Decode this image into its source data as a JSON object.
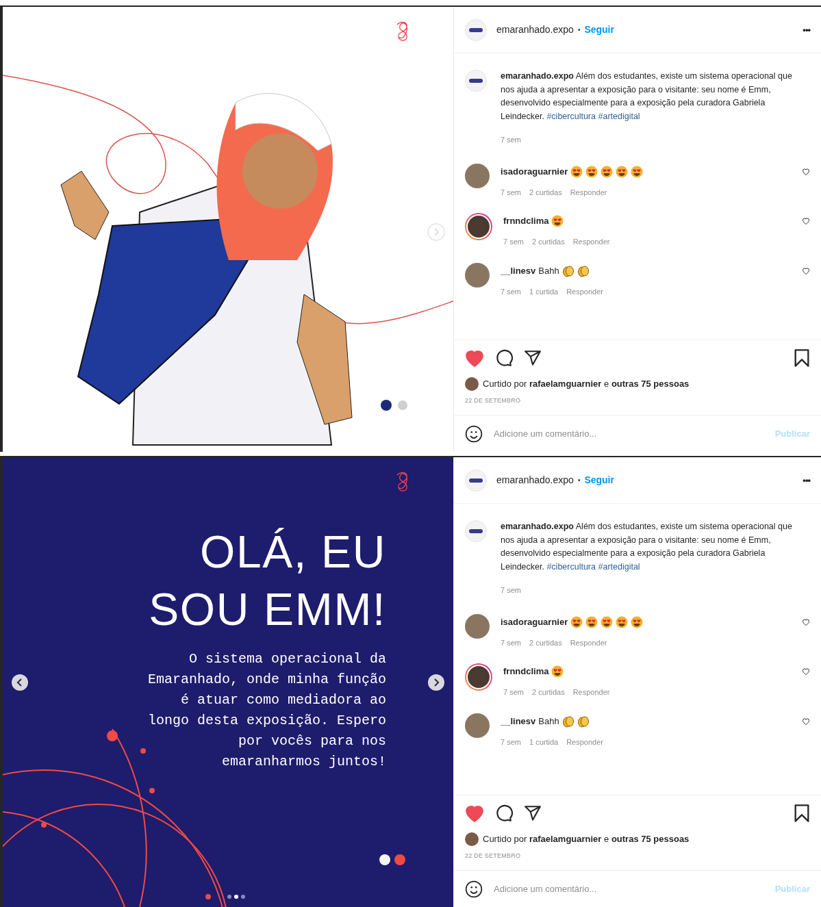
{
  "posts": [
    {
      "media": {
        "kind": "illustration",
        "arrows": [
          {
            "kind": "next"
          }
        ]
      },
      "header": {
        "username": "emaranhado.expo",
        "separator": "•",
        "follow": "Seguir",
        "more": "•••"
      },
      "caption": {
        "username": "emaranhado.expo",
        "text": "Além dos estudantes, existe um sistema operacional que nos ajuda a apresentar a exposição para o visitante: seu nome é Emm, desenvolvido especialmente para a exposição pela curadora Gabriela Leindecker.",
        "hashtags": [
          "#cibercultura",
          "#artedigital"
        ],
        "time": "7 sem"
      },
      "comments": [
        {
          "username": "isadoraguarnier",
          "emojis": [
            {
              "kind": "heart_eyes"
            },
            {
              "kind": "heart_eyes"
            },
            {
              "kind": "heart_eyes"
            },
            {
              "kind": "heart_eyes"
            },
            {
              "kind": "heart_eyes"
            }
          ],
          "story": false,
          "time": "7 sem",
          "likes": "2 curtidas",
          "reply": "Responder"
        },
        {
          "username": "frnndclima",
          "emojis": [
            {
              "kind": "heart_eyes"
            }
          ],
          "story": true,
          "time": "7 sem",
          "likes": "2 curtidas",
          "reply": "Responder"
        },
        {
          "username": "__linesv",
          "text": "Bahh",
          "emojis": [
            {
              "kind": "clap"
            },
            {
              "kind": "clap"
            }
          ],
          "story": false,
          "time": "7 sem",
          "likes": "1 curtida",
          "reply": "Responder"
        }
      ],
      "liked": true,
      "likes_text": "Curtido por **rafaelamguarnier** e **outras 75 pessoas**",
      "date": "22 DE SETEMBRO",
      "comment_box": {
        "placeholder": "Adicione um comentário...",
        "button": "Publicar",
        "disabled": true
      }
    },
    {
      "media": {
        "kind": "slide",
        "title": [
          "OLÁ, EU",
          "SOU EMM!"
        ],
        "body": [
          "O sistema operacional da",
          "Emaranhado, onde minha função",
          "é atuar como mediadora ao",
          "longo desta exposição. Espero",
          "por vocês para nos",
          "emaranharmos juntos!"
        ],
        "arrows": [
          {
            "kind": "prev"
          },
          {
            "kind": "next"
          }
        ],
        "carousel": [
          {
            "selected": false
          },
          {
            "selected": true
          },
          {
            "selected": false
          }
        ]
      },
      "header": {
        "username": "emaranhado.expo",
        "separator": "•",
        "follow": "Seguir",
        "more": "•••"
      },
      "caption": {
        "username": "emaranhado.expo",
        "text": "Além dos estudantes, existe um sistema operacional que nos ajuda a apresentar a exposição para o visitante: seu nome é Emm, desenvolvido especialmente para a exposição pela curadora Gabriela Leindecker.",
        "hashtags": [
          "#cibercultura",
          "#artedigital"
        ],
        "time": "7 sem"
      },
      "comments": [
        {
          "username": "isadoraguarnier",
          "emojis": [
            {
              "kind": "heart_eyes"
            },
            {
              "kind": "heart_eyes"
            },
            {
              "kind": "heart_eyes"
            },
            {
              "kind": "heart_eyes"
            },
            {
              "kind": "heart_eyes"
            }
          ],
          "story": false,
          "time": "7 sem",
          "likes": "2 curtidas",
          "reply": "Responder"
        },
        {
          "username": "frnndclima",
          "emojis": [
            {
              "kind": "heart_eyes"
            }
          ],
          "story": true,
          "time": "7 sem",
          "likes": "2 curtidas",
          "reply": "Responder"
        },
        {
          "username": "__linesv",
          "text": "Bahh",
          "emojis": [
            {
              "kind": "clap"
            },
            {
              "kind": "clap"
            }
          ],
          "story": false,
          "time": "7 sem",
          "likes": "1 curtida",
          "reply": "Responder"
        }
      ],
      "liked": true,
      "likes_text": "Curtido por **rafaelamguarnier** e **outras 75 pessoas**",
      "date": "22 DE SETEMBRO",
      "comment_box": {
        "placeholder": "Adicione um comentário...",
        "button": "Publicar",
        "disabled": true
      }
    }
  ]
}
